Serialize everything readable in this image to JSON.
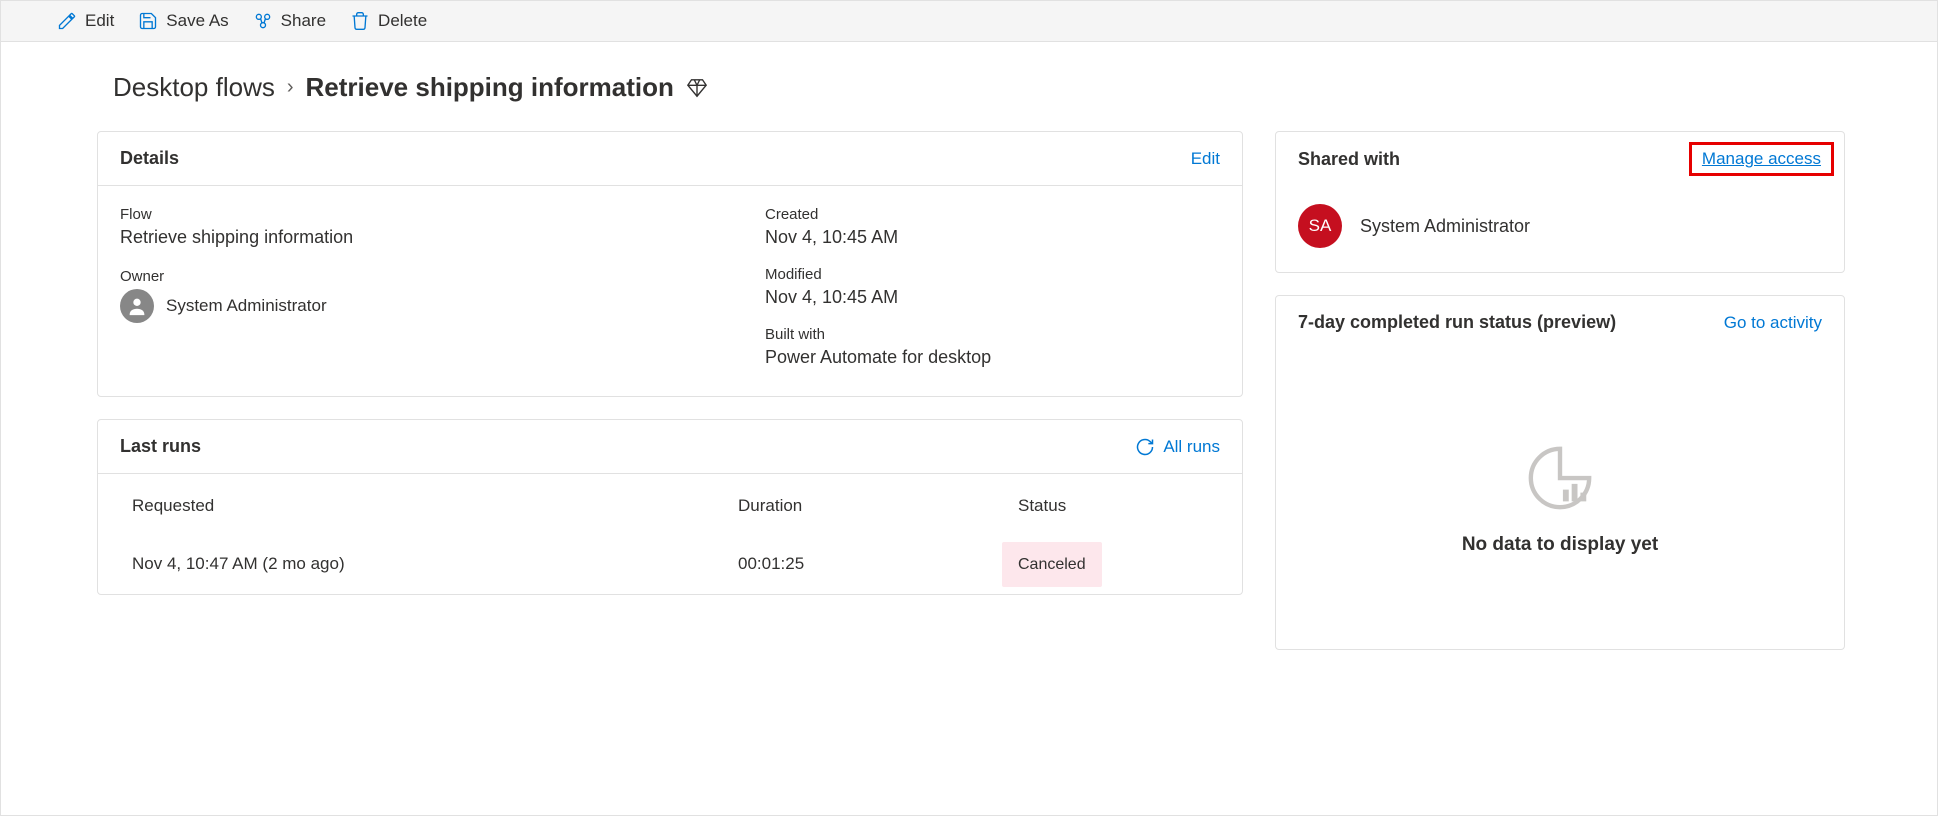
{
  "commandBar": {
    "edit": "Edit",
    "saveAs": "Save As",
    "share": "Share",
    "delete": "Delete"
  },
  "breadcrumb": {
    "root": "Desktop flows",
    "current": "Retrieve shipping information"
  },
  "detailsCard": {
    "title": "Details",
    "editLink": "Edit",
    "flowLabel": "Flow",
    "flowValue": "Retrieve shipping information",
    "ownerLabel": "Owner",
    "ownerValue": "System Administrator",
    "createdLabel": "Created",
    "createdValue": "Nov 4, 10:45 AM",
    "modifiedLabel": "Modified",
    "modifiedValue": "Nov 4, 10:45 AM",
    "builtWithLabel": "Built with",
    "builtWithValue": "Power Automate for desktop"
  },
  "lastRunsCard": {
    "title": "Last runs",
    "allRunsLink": "All runs",
    "headers": {
      "requested": "Requested",
      "duration": "Duration",
      "status": "Status"
    },
    "row": {
      "requested": "Nov 4, 10:47 AM (2 mo ago)",
      "duration": "00:01:25",
      "status": "Canceled"
    }
  },
  "sharedCard": {
    "title": "Shared with",
    "manageLink": "Manage access",
    "user": {
      "initials": "SA",
      "name": "System Administrator"
    }
  },
  "runStatusCard": {
    "title": "7-day completed run status (preview)",
    "goToActivity": "Go to activity",
    "noData": "No data to display yet"
  }
}
